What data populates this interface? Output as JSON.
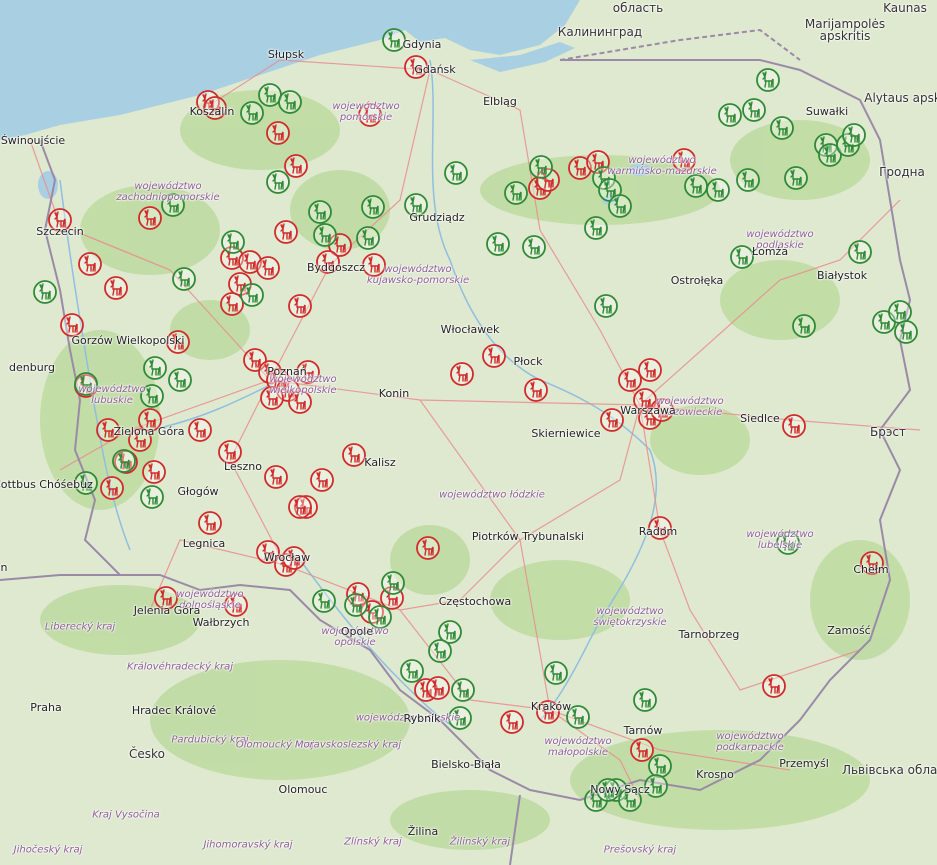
{
  "map": {
    "colors": {
      "land": "#dfe9cf",
      "water": "#a9cfe3",
      "forest": "#b9d89a",
      "border": "#9a8aa8",
      "road": "#e88e8e",
      "red_marker": "#d02a2a",
      "green_marker": "#2f8a36"
    },
    "marker_icon": "deer-icon",
    "countries": [
      "область",
      "Калининград",
      "Marijampolės apskritis",
      "Kaunas",
      "Alytaus apskr",
      "Гродна",
      "Брэст",
      "Česko",
      "Львівська область"
    ],
    "regions": [
      "województwo pomorskie",
      "województwo zachodniopomorskie",
      "województwo warmińsko-mazurskie",
      "województwo podlaskie",
      "województwo kujawsko-pomorskie",
      "województwo wielkopolskie",
      "województwo lubuskie",
      "województwo mazowieckie",
      "województwo łódzkie",
      "województwo lubelskie",
      "województwo dolnośląskie",
      "województwo opolskie",
      "województwo śląskie",
      "województwo świętokrzyskie",
      "województwo małopolskie",
      "województwo podkarpackie",
      "Liberecký kraj",
      "Královéhradecký kraj",
      "Pardubický kraj",
      "Olomoucký kraj",
      "Moravskoslezský kraj",
      "Kraj Vysočina",
      "Jihomoravský kraj",
      "Zlínský kraj",
      "Žilinský kraj",
      "Prešovský kraj",
      "Jihočeský kraj"
    ],
    "cities": [
      "Gdynia",
      "Gdańsk",
      "Słupsk",
      "Koszalin",
      "Świnoujście",
      "Szczecin",
      "Elbląg",
      "Suwałki",
      "Grudziądz",
      "Bydgoszcz",
      "Łomża",
      "Ostrołęka",
      "Białystok",
      "Gorzów Wielkopolski",
      "Włocławek",
      "Płock",
      "Poznań",
      "Konin",
      "Warszawa",
      "Zielona Góra",
      "Skierniewice",
      "Siedlce",
      "Cottbus Chóśebuz",
      "Leszno",
      "Kalisz",
      "Głogów",
      "Piotrków Trybunalski",
      "Radom",
      "Legnica",
      "Wrocław",
      "Chełm",
      "Jelenia Góra",
      "Wałbrzych",
      "Częstochowa",
      "Tarnobrzeg",
      "Zamość",
      "Opole",
      "Praha",
      "Hradec Králové",
      "Rybnik",
      "Kraków",
      "Tarnów",
      "Bielsko-Biała",
      "Krosno",
      "Przemyśl",
      "Olomouc",
      "Nowy Sącz",
      "Žilina",
      "denburg",
      "n"
    ]
  }
}
